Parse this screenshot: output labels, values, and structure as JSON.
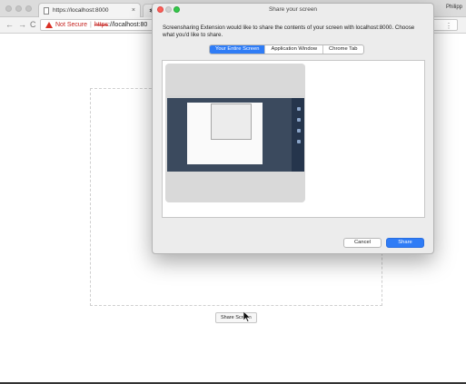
{
  "browser": {
    "tab_title": "https://localhost:8000",
    "tab_close": "×",
    "tab2_icon": "puzzle-icon",
    "profile": "Philipp",
    "address": {
      "not_secure": "Not Secure",
      "separator": "|",
      "scheme": "https",
      "host": "://localhost:80"
    },
    "omnibox_right_glyph": "⋮"
  },
  "page": {
    "share_button_label": "Share Screen"
  },
  "dialog": {
    "title": "Share your screen",
    "message": "Screensharing Extension would like to share the contents of your screen with localhost:8000. Choose what you'd like to share.",
    "tabs": [
      {
        "label": "Your Entire Screen",
        "active": true
      },
      {
        "label": "Application Window",
        "active": false
      },
      {
        "label": "Chrome Tab",
        "active": false
      }
    ],
    "cancel_label": "Cancel",
    "share_label": "Share"
  },
  "colors": {
    "accent": "#2f7cf6",
    "warning": "#d93025"
  }
}
